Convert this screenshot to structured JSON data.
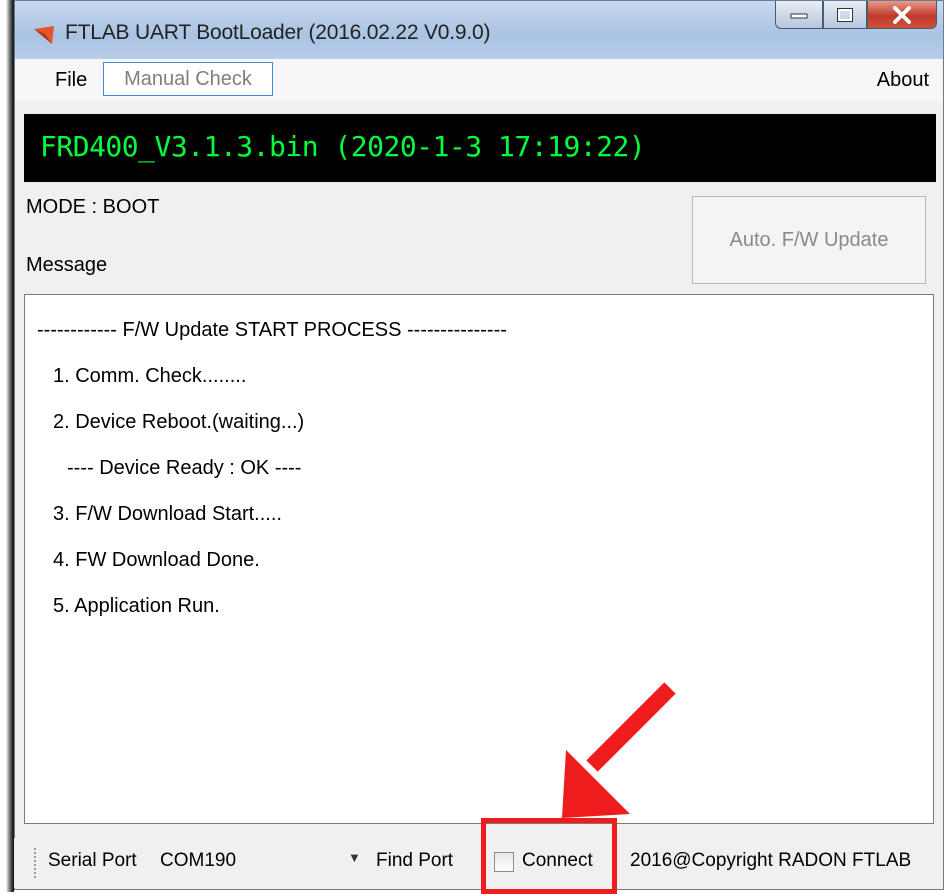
{
  "window": {
    "title": "FTLAB UART BootLoader (2016.02.22 V0.9.0)",
    "controls": [
      "minimize-icon",
      "maximize-icon",
      "close-icon"
    ]
  },
  "menu": {
    "file": "File",
    "manual_check": "Manual Check",
    "about": "About"
  },
  "firmware_file": "FRD400_V3.1.3.bin (2020-1-3 17:19:22)",
  "mode": "MODE : BOOT",
  "message_label": "Message",
  "auto_update_button": "Auto. F/W Update",
  "log_lines": [
    "------------ F/W Update START PROCESS ---------------",
    "1. Comm. Check........",
    "2. Device Reboot.(waiting...)",
    "---- Device Ready : OK ----",
    "3. F/W Download Start.....",
    "4. FW Download Done.",
    "5. Application Run."
  ],
  "status": {
    "serial_port_label": "Serial Port",
    "serial_port_value": "COM190",
    "find_port": "Find Port",
    "connect_label": "Connect",
    "connect_checked": false,
    "copyright": "2016@Copyright RADON FTLAB"
  },
  "colors": {
    "firmware_text": "#00ff3c",
    "annotation": "#ee1c1c"
  }
}
